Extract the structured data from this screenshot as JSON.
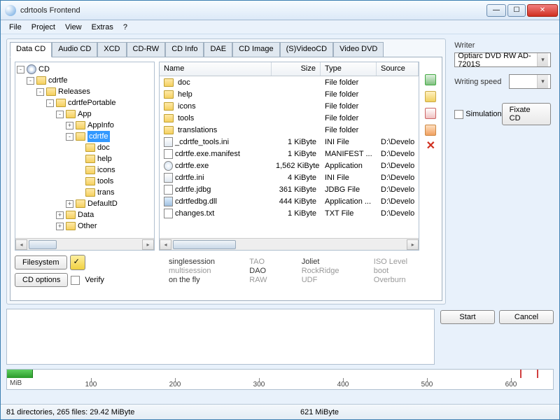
{
  "window": {
    "title": "cdrtools Frontend"
  },
  "menu": [
    "File",
    "Project",
    "View",
    "Extras",
    "?"
  ],
  "tabs": [
    "Data CD",
    "Audio CD",
    "XCD",
    "CD-RW",
    "CD Info",
    "DAE",
    "CD Image",
    "(S)VideoCD",
    "Video DVD"
  ],
  "tree": [
    {
      "depth": 0,
      "toggle": "-",
      "icon": "cd",
      "label": "CD"
    },
    {
      "depth": 1,
      "toggle": "-",
      "icon": "folder",
      "label": "cdrtfe"
    },
    {
      "depth": 2,
      "toggle": "-",
      "icon": "folder",
      "label": "Releases"
    },
    {
      "depth": 3,
      "toggle": "-",
      "icon": "folder",
      "label": "cdrtfePortable"
    },
    {
      "depth": 4,
      "toggle": "-",
      "icon": "folder",
      "label": "App"
    },
    {
      "depth": 5,
      "toggle": "+",
      "icon": "folder",
      "label": "AppInfo"
    },
    {
      "depth": 5,
      "toggle": "-",
      "icon": "folder",
      "label": "cdrtfe",
      "sel": true
    },
    {
      "depth": 6,
      "toggle": "",
      "icon": "folder",
      "label": "doc"
    },
    {
      "depth": 6,
      "toggle": "",
      "icon": "folder",
      "label": "help"
    },
    {
      "depth": 6,
      "toggle": "",
      "icon": "folder",
      "label": "icons"
    },
    {
      "depth": 6,
      "toggle": "",
      "icon": "folder",
      "label": "tools"
    },
    {
      "depth": 6,
      "toggle": "",
      "icon": "folder",
      "label": "trans"
    },
    {
      "depth": 5,
      "toggle": "+",
      "icon": "folder",
      "label": "DefaultD"
    },
    {
      "depth": 4,
      "toggle": "+",
      "icon": "folder",
      "label": "Data"
    },
    {
      "depth": 4,
      "toggle": "+",
      "icon": "folder",
      "label": "Other"
    }
  ],
  "list_headers": {
    "name": "Name",
    "size": "Size",
    "type": "Type",
    "source": "Source"
  },
  "files": [
    {
      "icon": "folder",
      "name": "doc",
      "size": "",
      "type": "File folder",
      "source": ""
    },
    {
      "icon": "folder",
      "name": "help",
      "size": "",
      "type": "File folder",
      "source": ""
    },
    {
      "icon": "folder",
      "name": "icons",
      "size": "",
      "type": "File folder",
      "source": ""
    },
    {
      "icon": "folder",
      "name": "tools",
      "size": "",
      "type": "File folder",
      "source": ""
    },
    {
      "icon": "folder",
      "name": "translations",
      "size": "",
      "type": "File folder",
      "source": ""
    },
    {
      "icon": "ini",
      "name": "_cdrtfe_tools.ini",
      "size": "1 KiByte",
      "type": "INI File",
      "source": "D:\\Develo"
    },
    {
      "icon": "file",
      "name": "cdrtfe.exe.manifest",
      "size": "1 KiByte",
      "type": "MANIFEST ...",
      "source": "D:\\Develo"
    },
    {
      "icon": "exe",
      "name": "cdrtfe.exe",
      "size": "1,562 KiByte",
      "type": "Application",
      "source": "D:\\Develo"
    },
    {
      "icon": "ini",
      "name": "cdrtfe.ini",
      "size": "4 KiByte",
      "type": "INI File",
      "source": "D:\\Develo"
    },
    {
      "icon": "file",
      "name": "cdrtfe.jdbg",
      "size": "361 KiByte",
      "type": "JDBG File",
      "source": "D:\\Develo"
    },
    {
      "icon": "dll",
      "name": "cdrtfedbg.dll",
      "size": "444 KiByte",
      "type": "Application ...",
      "source": "D:\\Develo"
    },
    {
      "icon": "file",
      "name": "changes.txt",
      "size": "1 KiByte",
      "type": "TXT File",
      "source": "D:\\Develo"
    }
  ],
  "buttons": {
    "filesystem": "Filesystem",
    "cd_options": "CD options",
    "verify": "Verify"
  },
  "meta": {
    "r1c1": "singlesession",
    "r1c2": "TAO",
    "r1c3": "Joliet",
    "r1c4": "ISO Level",
    "r2c1": "multisession",
    "r2c2": "DAO",
    "r2c3": "RockRidge",
    "r2c4": "boot",
    "r3c1": "on the fly",
    "r3c2": "RAW",
    "r3c3": "UDF",
    "r3c4": "Overburn"
  },
  "right": {
    "writer_label": "Writer",
    "writer_value": "Optiarc DVD RW AD-7201S",
    "speed_label": "Writing speed",
    "simulation": "Simulation",
    "fixate": "Fixate CD"
  },
  "actions": {
    "start": "Start",
    "cancel": "Cancel"
  },
  "ruler": {
    "unit": "MiB",
    "ticks": [
      "100",
      "200",
      "300",
      "400",
      "500",
      "600"
    ],
    "fill_pct": 4.7
  },
  "status": {
    "left": "81 directories, 265 files: 29.42 MiByte",
    "right": "621 MiByte"
  }
}
